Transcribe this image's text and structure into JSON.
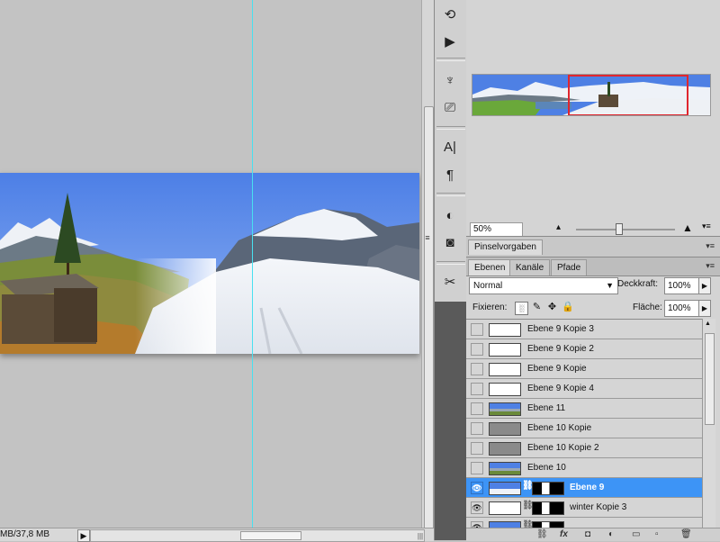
{
  "status": {
    "doc_size": "MB/37,8 MB"
  },
  "toolstrip": [
    {
      "icon": "history-icon",
      "glyph": "⟲"
    },
    {
      "icon": "actions-play-icon",
      "glyph": "▶"
    },
    {
      "icon": "brush-presets-icon",
      "glyph": "♆"
    },
    {
      "icon": "clone-source-icon",
      "glyph": "⎚"
    },
    {
      "icon": "character-icon",
      "glyph": "A|"
    },
    {
      "icon": "paragraph-icon",
      "glyph": "¶"
    },
    {
      "icon": "adjustments-icon",
      "glyph": "◐"
    },
    {
      "icon": "masks-icon",
      "glyph": "◙"
    },
    {
      "icon": "tools-icon",
      "glyph": "✂"
    }
  ],
  "navigator": {
    "zoom": "50%"
  },
  "brush_panel": {
    "tab_label": "Pinselvorgaben"
  },
  "layers_panel": {
    "tabs": [
      {
        "label": "Ebenen",
        "active": true
      },
      {
        "label": "Kanäle",
        "active": false
      },
      {
        "label": "Pfade",
        "active": false
      }
    ],
    "blend_mode": "Normal",
    "opacity_label": "Deckkraft:",
    "opacity": "100%",
    "lock_label": "Fixieren:",
    "fill_label": "Fläche:",
    "fill": "100%",
    "layers": [
      {
        "name": "Ebene 9 Kopie 3",
        "visible": false,
        "selected": false,
        "thumb": "white",
        "mask": false
      },
      {
        "name": "Ebene 9 Kopie 2",
        "visible": false,
        "selected": false,
        "thumb": "white",
        "mask": false
      },
      {
        "name": "Ebene 9 Kopie",
        "visible": false,
        "selected": false,
        "thumb": "white",
        "mask": false
      },
      {
        "name": "Ebene 9 Kopie 4",
        "visible": false,
        "selected": false,
        "thumb": "white",
        "mask": false
      },
      {
        "name": "Ebene 11",
        "visible": false,
        "selected": false,
        "thumb": "landscape",
        "mask": false
      },
      {
        "name": "Ebene 10 Kopie",
        "visible": false,
        "selected": false,
        "thumb": "gray",
        "mask": false
      },
      {
        "name": "Ebene 10 Kopie 2",
        "visible": false,
        "selected": false,
        "thumb": "gray",
        "mask": false
      },
      {
        "name": "Ebene 10",
        "visible": false,
        "selected": false,
        "thumb": "landscape",
        "mask": false
      },
      {
        "name": "Ebene 9",
        "visible": true,
        "selected": true,
        "thumb": "sky",
        "mask": true
      },
      {
        "name": "winter Kopie 3",
        "visible": true,
        "selected": false,
        "thumb": "white",
        "mask": true
      },
      {
        "name": "",
        "visible": true,
        "selected": false,
        "thumb": "landscape",
        "mask": true
      }
    ]
  },
  "colors": {
    "selection": "#3d94f6",
    "guide": "#48e0f0",
    "nav_frame": "#e0262e"
  }
}
